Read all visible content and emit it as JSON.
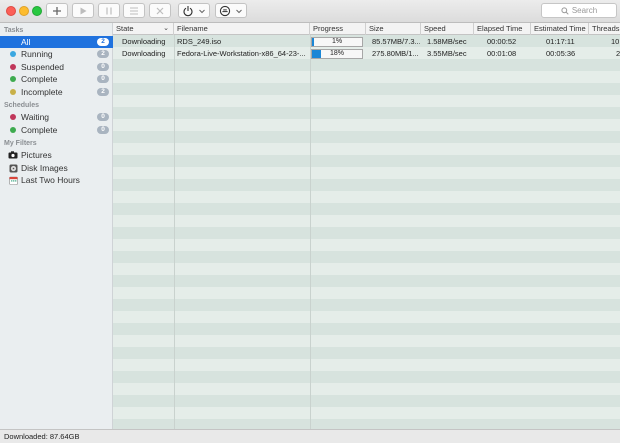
{
  "toolbar": {
    "buttons": [
      {
        "name": "add-download-button",
        "icon": "plus-icon"
      },
      {
        "name": "resume-button",
        "icon": "play-icon"
      },
      {
        "name": "pause-button",
        "icon": "pause-icon"
      },
      {
        "name": "list-button",
        "icon": "list-icon"
      },
      {
        "name": "remove-button",
        "icon": "x-icon"
      },
      {
        "name": "power-menu-button",
        "icon": "power-icon"
      },
      {
        "name": "speed-limit-button",
        "icon": "speed-icon"
      }
    ],
    "search_placeholder": "Search"
  },
  "sidebar": {
    "tasks_title": "Tasks",
    "tasks": [
      {
        "label": "All",
        "count": "2",
        "color": "#1f72de",
        "active": true
      },
      {
        "label": "Running",
        "count": "2",
        "color": "#3aa7e0"
      },
      {
        "label": "Suspended",
        "count": "0",
        "color": "#c0365a"
      },
      {
        "label": "Complete",
        "count": "0",
        "color": "#3eab4f"
      },
      {
        "label": "Incomplete",
        "count": "2",
        "color": "#c8b048"
      }
    ],
    "schedules_title": "Schedules",
    "schedules": [
      {
        "label": "Waiting",
        "count": "0",
        "color": "#c0365a"
      },
      {
        "label": "Complete",
        "count": "0",
        "color": "#3eab4f"
      }
    ],
    "filters_title": "My Filters",
    "filters": [
      {
        "label": "Pictures",
        "icon": "camera-icon"
      },
      {
        "label": "Disk Images",
        "icon": "disk-icon"
      },
      {
        "label": "Last Two Hours",
        "icon": "calendar-icon"
      }
    ]
  },
  "table": {
    "columns": [
      "State",
      "Filename",
      "Progress",
      "Size",
      "Speed",
      "Elapsed Time",
      "Estimated Time",
      "Threads"
    ],
    "rows": [
      {
        "state": "Downloading",
        "filename": "RDS_249.iso",
        "progress_label": "1%",
        "progress": 0.01,
        "size": "85.57MB/7.3...",
        "speed": "1.58MB/sec",
        "elapsed": "00:00:52",
        "estimated": "01:17:11",
        "threads": "10"
      },
      {
        "state": "Downloading",
        "filename": "Fedora-Live-Workstation-x86_64-23-...",
        "progress_label": "18%",
        "progress": 0.18,
        "size": "275.80MB/1...",
        "speed": "3.55MB/sec",
        "elapsed": "00:01:08",
        "estimated": "00:05:36",
        "threads": "2"
      }
    ]
  },
  "status": {
    "downloaded": "Downloaded: 87.64GB"
  }
}
